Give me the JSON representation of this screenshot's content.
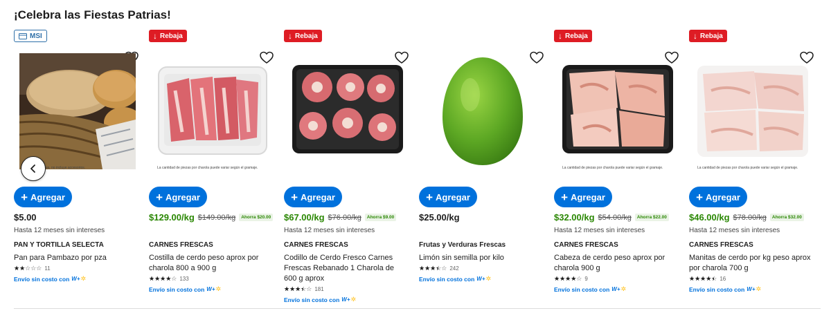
{
  "section_title": "¡Celebra las Fiestas Patrias!",
  "add_label": "Agregar",
  "badges": {
    "msi": "MSI",
    "rebaja": "Rebaja"
  },
  "shipping_text": "Envío sin costo con",
  "shipping_brand": "W+",
  "colors": {
    "accent": "#0071dc",
    "sale_green": "#2a8703",
    "rebaja_red": "#de1c24"
  },
  "products": [
    {
      "badge": "msi",
      "price": "$5.00",
      "old_price": "",
      "saving": "",
      "msi_text": "Hasta 12 meses sin intereses",
      "department": "PAN Y TORTILLA SELECTA",
      "name": "Pan para Pambazo por pza",
      "rating": 2,
      "reviews": "11",
      "shipping": true,
      "image_caption": "Imagen ilustrativa, no incluye accesorios.",
      "image": "bread"
    },
    {
      "badge": "rebaja",
      "price": "$129.00/kg",
      "old_price": "$149.00/kg",
      "saving": "Ahorra $20.00",
      "msi_text": "",
      "department": "CARNES FRESCAS",
      "name": "Costilla de cerdo peso aprox por charola 800 a 900 g",
      "rating": 4,
      "reviews": "133",
      "shipping": true,
      "image_caption": "La cantidad de piezas por charola puede variar según el gramaje.",
      "image": "ribs"
    },
    {
      "badge": "rebaja",
      "price": "$67.00/kg",
      "old_price": "$76.00/kg",
      "saving": "Ahorra $9.00",
      "msi_text": "Hasta 12 meses sin intereses",
      "department": "CARNES FRESCAS",
      "name": "Codillo de Cerdo Fresco Carnes Frescas Rebanado 1 Charola de 600 g aprox",
      "rating": 3.5,
      "reviews": "181",
      "shipping": true,
      "image_caption": "",
      "image": "shank"
    },
    {
      "badge": "",
      "price": "$25.00/kg",
      "old_price": "",
      "saving": "",
      "msi_text": "",
      "department": "Frutas y Verduras Frescas",
      "name": "Limón sin semilla por kilo",
      "rating": 3.5,
      "reviews": "242",
      "shipping": true,
      "image_caption": "",
      "image": "lime"
    },
    {
      "badge": "rebaja",
      "price": "$32.00/kg",
      "old_price": "$54.00/kg",
      "saving": "Ahorra $22.00",
      "msi_text": "Hasta 12 meses sin intereses",
      "department": "CARNES FRESCAS",
      "name": "Cabeza de cerdo peso aprox por charola 900 g",
      "rating": 4,
      "reviews": "9",
      "shipping": true,
      "image_caption": "La cantidad de piezas por charola puede variar según el gramaje.",
      "image": "head"
    },
    {
      "badge": "rebaja",
      "price": "$46.00/kg",
      "old_price": "$78.00/kg",
      "saving": "Ahorra $32.00",
      "msi_text": "Hasta 12 meses sin intereses",
      "department": "CARNES FRESCAS",
      "name": "Manitas de cerdo por kg peso aprox por charola 700 g",
      "rating": 4.5,
      "reviews": "16",
      "shipping": true,
      "image_caption": "La cantidad de piezas por charola puede variar según el gramaje.",
      "image": "trotters"
    }
  ]
}
